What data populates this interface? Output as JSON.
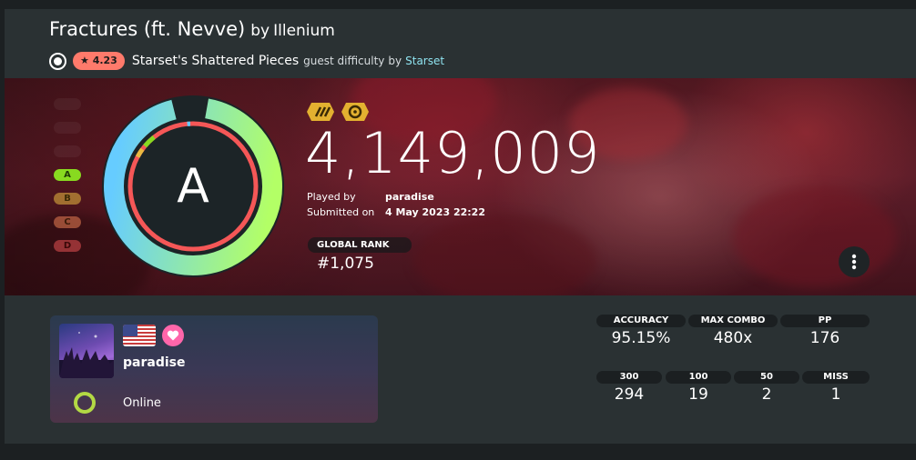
{
  "header": {
    "song_title": "Fractures (ft. Nevve)",
    "by_word": "by",
    "artist": "Illenium",
    "star_rating": "★ 4.23",
    "difficulty_name": "Starset's Shattered Pieces",
    "guest_label": "guest difficulty",
    "guest_by": "by",
    "mapper": "Starset"
  },
  "score": {
    "grade": "A",
    "rank_list": [
      "A",
      "B",
      "C",
      "D"
    ],
    "total": "4,149,009",
    "played_by_label": "Played by",
    "played_by_value": "paradise",
    "submitted_label": "Submitted on",
    "submitted_value": "4 May 2023 22:22",
    "global_rank_label": "GLOBAL RANK",
    "global_rank_value": "#1,075",
    "mods": [
      "double-slash-mod-icon",
      "target-mod-icon"
    ]
  },
  "user": {
    "username": "paradise",
    "status": "Online",
    "country_flag": "us-flag-icon",
    "supporter": "heart-icon"
  },
  "stats": {
    "accuracy_label": "ACCURACY",
    "accuracy_value": "95.15%",
    "max_combo_label": "MAX COMBO",
    "max_combo_value": "480x",
    "pp_label": "PP",
    "pp_value": "176",
    "c300_label": "300",
    "c300_value": "294",
    "c100_label": "100",
    "c100_value": "19",
    "c50_label": "50",
    "c50_value": "2",
    "miss_label": "MISS",
    "miss_value": "1"
  },
  "colors": {
    "accent_star": "#ff7a6b",
    "grade_a": "#88da20",
    "grade_b": "#e9b941",
    "grade_c": "#fa8a59",
    "grade_d": "#f55757",
    "ring_green": "#b3ff66",
    "ring_blue": "#66ccff",
    "status_green": "#b3d944",
    "supporter_pink": "#ff66aa"
  }
}
